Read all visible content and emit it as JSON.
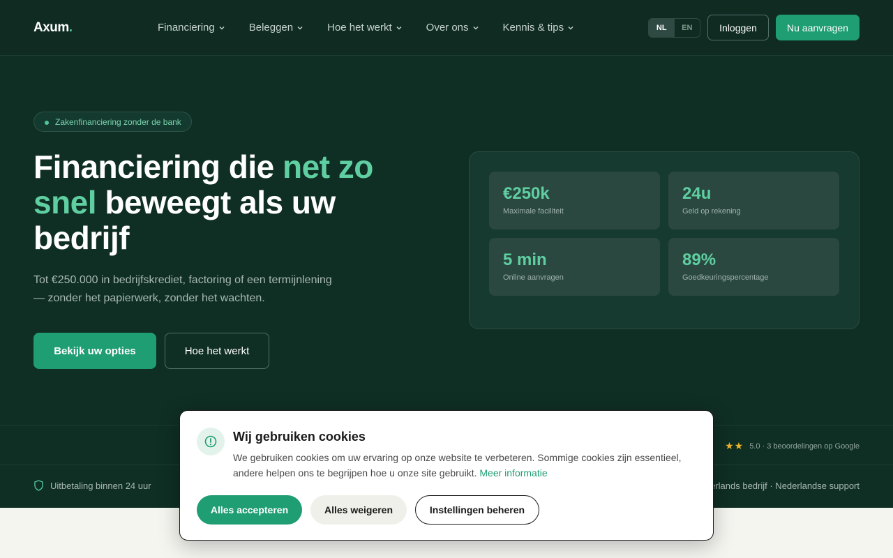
{
  "nav": {
    "logo": "Axum",
    "logo_dot": ".",
    "menu": [
      {
        "label": "Financiering"
      },
      {
        "label": "Beleggen"
      },
      {
        "label": "Hoe het werkt"
      },
      {
        "label": "Over ons"
      },
      {
        "label": "Kennis & tips"
      }
    ],
    "lang": {
      "nl": "NL",
      "en": "EN",
      "active": "NL"
    },
    "login_label": "Inloggen",
    "apply_label": "Nu aanvragen"
  },
  "hero": {
    "badge": "Zakenfinanciering zonder de bank",
    "title_part1": "Financiering die ",
    "title_accent": "net zo snel",
    "title_part2": " beweegt als uw bedrijf",
    "subtitle": "Tot €250.000 in bedrijfskrediet, factoring of een termijnlening — zonder het papierwerk, zonder het wachten.",
    "primary_cta": "Bekijk uw opties",
    "secondary_cta": "Hoe het werkt",
    "stats": [
      {
        "value": "€250k",
        "label": "Maximale faciliteit"
      },
      {
        "value": "24u",
        "label": "Geld op rekening"
      },
      {
        "value": "5 min",
        "label": "Online aanvragen"
      },
      {
        "value": "89%",
        "label": "Goedkeuringspercentage"
      }
    ]
  },
  "trust": {
    "stars": "★★",
    "rating_text": "5.0 · 3 beoordelingen op Google",
    "payout": "Uitbetaling binnen 24 uur",
    "right_text": "erlands bedrijf · Nederlandse support"
  },
  "cookie": {
    "title": "Wij gebruiken cookies",
    "text": "We gebruiken cookies om uw ervaring op onze website te verbeteren. Sommige cookies zijn essentieel, andere helpen ons te begrijpen hoe u onze site gebruikt.",
    "link": "Meer informatie",
    "accept": "Alles accepteren",
    "reject": "Alles weigeren",
    "settings": "Instellingen beheren"
  },
  "colors": {
    "background": "#0f2e24",
    "accent": "#1f9d73",
    "accent_text": "#5fcfa2",
    "star": "#f0b429"
  }
}
